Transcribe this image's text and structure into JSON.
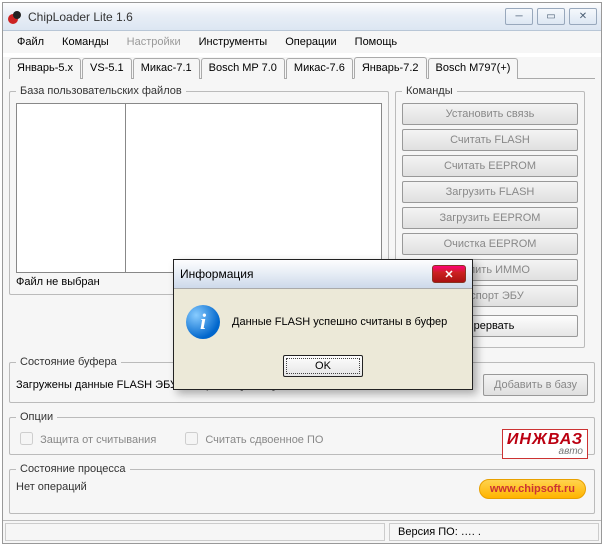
{
  "window": {
    "title": "ChipLoader Lite 1.6"
  },
  "menu": {
    "file": "Файл",
    "commands": "Команды",
    "settings": "Настройки",
    "tools": "Инструменты",
    "operations": "Операции",
    "help": "Помощь"
  },
  "tabs": [
    "Январь-5.x",
    "VS-5.1",
    "Микас-7.1",
    "Bosch MP 7.0",
    "Микас-7.6",
    "Январь-7.2",
    "Bosch M797(+)"
  ],
  "active_tab_index": 5,
  "files_group": {
    "legend": "База пользовательских файлов",
    "status": "Файл не выбран"
  },
  "commands": {
    "legend": "Команды",
    "buttons": [
      "Установить связь",
      "Считать FLASH",
      "Считать EEPROM",
      "Загрузить FLASH",
      "Загрузить EEPROM",
      "Очистка EEPROM",
      "Удалить ИММО",
      "Паспорт ЭБУ"
    ],
    "abort": "Прервать"
  },
  "buffer": {
    "legend": "Состояние буфера",
    "text": "Загружены данные FLASH ЭБУ Январь-7.2 [  ….. . ] , 65536 байт",
    "add": "Добавить в базу"
  },
  "options": {
    "legend": "Опции",
    "read_protect": "Защита от считывания",
    "read_double": "Считать сдвоенное ПО"
  },
  "logo": {
    "line1": "ИНЖВАЗ",
    "line2": "авто"
  },
  "process": {
    "legend": "Состояние процесса",
    "text": "Нет операций"
  },
  "chipsoft": "www.chipsoft.ru",
  "statusbar": {
    "version": "Версия ПО:  …. ."
  },
  "dialog": {
    "title": "Информация",
    "message": "Данные FLASH успешно считаны в буфер",
    "ok": "OK"
  }
}
